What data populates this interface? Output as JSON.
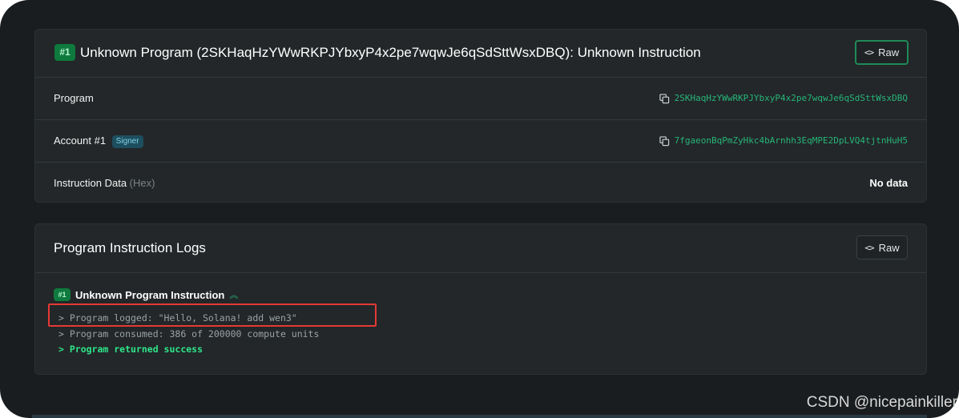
{
  "instruction_card": {
    "badge": "#1",
    "title": "Unknown Program (2SKHaqHzYWwRKPJYbxyP4x2pe7wqwJe6qSdSttWsxDBQ): Unknown Instruction",
    "raw_label": "Raw",
    "rows": {
      "program": {
        "label": "Program",
        "value": "2SKHaqHzYWwRKPJYbxyP4x2pe7wqwJe6qSdSttWsxDBQ"
      },
      "account": {
        "label": "Account #1",
        "tag": "Signer",
        "value": "7fgaeonBqPmZyHkc4bArnhh3EqMPE2DpLVQ4tjtnHuH5"
      },
      "data": {
        "label": "Instruction Data",
        "hint": "(Hex)",
        "value": "No data"
      }
    }
  },
  "logs_card": {
    "title": "Program Instruction Logs",
    "raw_label": "Raw",
    "entry": {
      "badge": "#1",
      "title": "Unknown Program Instruction",
      "lines": [
        "> Program logged: \"Hello, Solana! add wen3\"",
        "> Program consumed: 386 of 200000 compute units",
        "> Program returned success"
      ]
    }
  },
  "watermark": "CSDN @nicepainkiller",
  "colors": {
    "accent_green": "#26b579",
    "success_green": "#2ee58a",
    "highlight_red": "#e53935",
    "card_bg": "#232729",
    "page_bg": "#1a1d1f"
  }
}
